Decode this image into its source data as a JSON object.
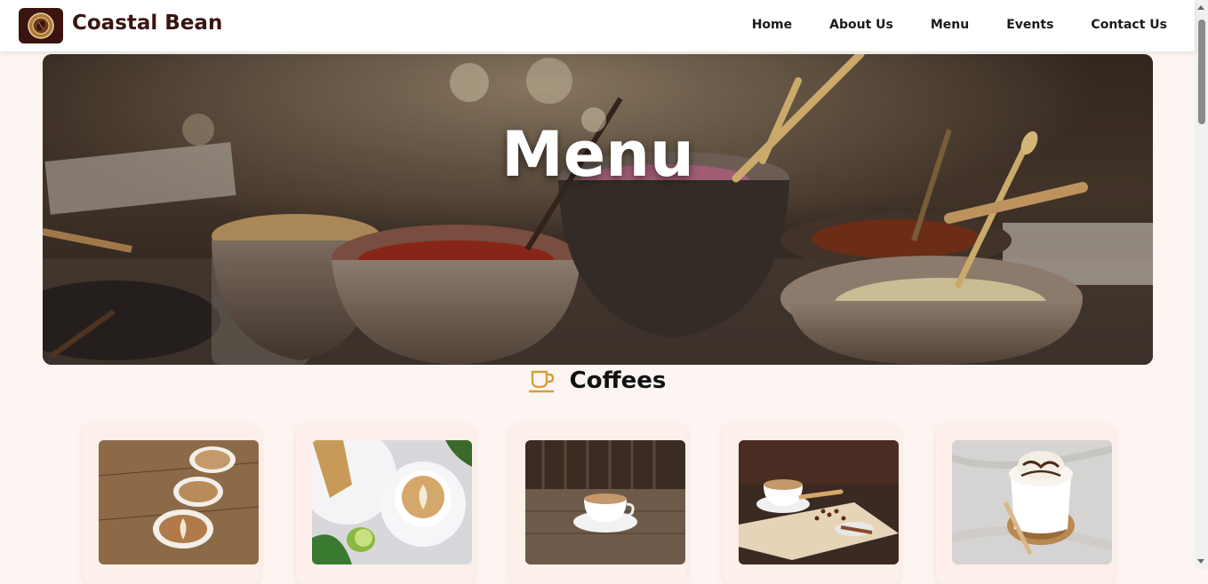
{
  "header": {
    "brand": "Coastal Bean",
    "logo_icon": "coffee-bean-logo-icon",
    "nav": [
      "Home",
      "About Us",
      "Menu",
      "Events",
      "Contact Us"
    ]
  },
  "hero": {
    "title": "Menu",
    "image": "bowls-of-food-on-table-photo"
  },
  "section": {
    "icon": "coffee-cup-icon",
    "title": "Coffees"
  },
  "cards": [
    {
      "image": "three-latte-art-cups-on-wood"
    },
    {
      "image": "latte-with-lime-and-pie"
    },
    {
      "image": "coffee-cup-on-wooden-table"
    },
    {
      "image": "cappuccino-on-serving-board-with-spices"
    },
    {
      "image": "hot-chocolate-with-whipped-cream"
    }
  ],
  "colors": {
    "page_bg": "#fdf5f1",
    "brand": "#3a1410",
    "accent": "#d4a03a",
    "card_bg": "#fdf0ea"
  }
}
